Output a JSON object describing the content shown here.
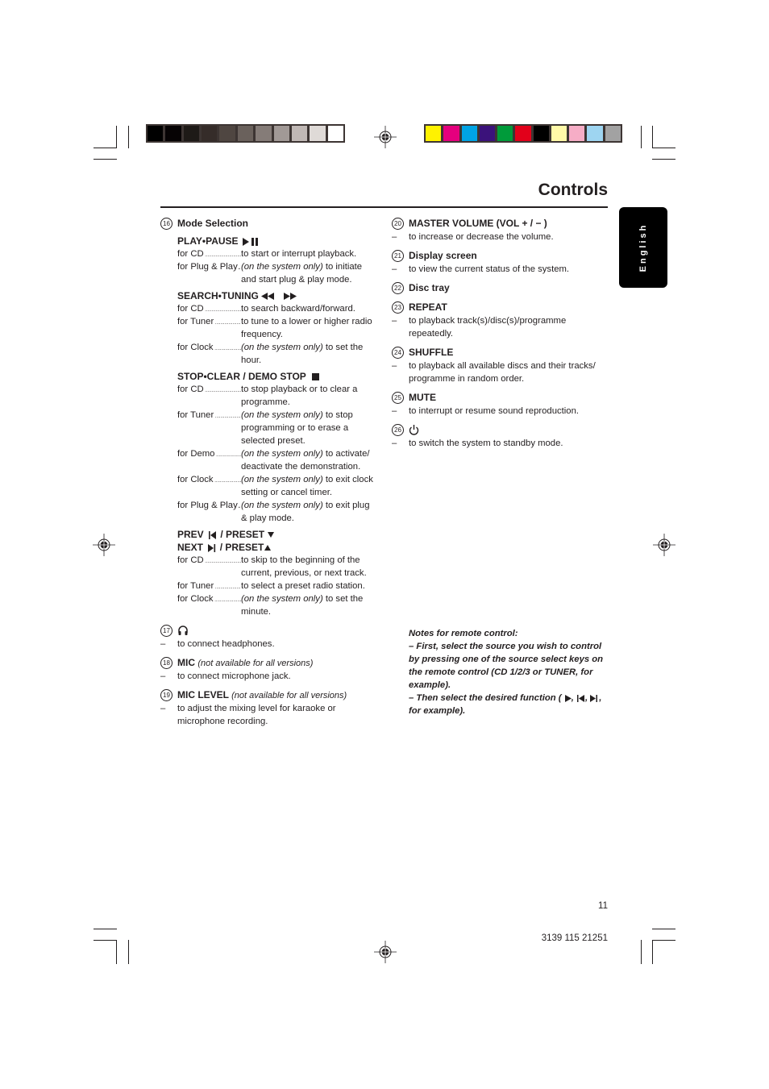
{
  "print_marks": {
    "grayscale_bar": [
      "#000000",
      "#060304",
      "#1e1a17",
      "#352c29",
      "#4f4641",
      "#6a615c",
      "#857c78",
      "#a19996",
      "#c0b8b5",
      "#dfdad7",
      "#ffffff"
    ],
    "color_bar": [
      "#fff200",
      "#e5007e",
      "#00a4e4",
      "#3b127b",
      "#009b3a",
      "#e2001a",
      "#000000",
      "#fff9a8",
      "#f6adc6",
      "#9ed5f1",
      "#a2a2a2"
    ]
  },
  "page": {
    "title": "Controls",
    "language_tab": "English",
    "page_number": "11",
    "doc_code": "3139 115 21251"
  },
  "left_column": {
    "item16": {
      "number": "16",
      "heading": "Mode Selection",
      "play_pause": {
        "heading": "PLAY•PAUSE",
        "icon": "play-pause-icon",
        "rows": [
          {
            "label": "for CD",
            "prefix_italic": "",
            "text": "to start or interrupt playback."
          },
          {
            "label": "for Plug & Play…",
            "prefix_italic": "(on the system only)",
            "text": " to initiate and start plug & play mode."
          }
        ]
      },
      "search_tuning": {
        "heading": "SEARCH•TUNING",
        "icons": [
          "rewind-icon",
          "fast-forward-icon"
        ],
        "rows": [
          {
            "label": "for CD",
            "prefix_italic": "",
            "text": "to search backward/forward."
          },
          {
            "label": "for Tuner",
            "prefix_italic": "",
            "text": "to tune to a lower or higher radio frequency."
          },
          {
            "label": "for Clock",
            "prefix_italic": "(on the system only)",
            "text": " to set the hour."
          }
        ]
      },
      "stop_clear": {
        "heading": "STOP•CLEAR / DEMO STOP",
        "icon": "stop-icon",
        "rows": [
          {
            "label": "for CD",
            "prefix_italic": "",
            "text": "to stop playback or to clear a programme."
          },
          {
            "label": "for Tuner",
            "prefix_italic": "(on the system only)",
            "text": " to stop programming or to erase a selected preset."
          },
          {
            "label": "for Demo",
            "prefix_italic": "(on the system only)",
            "text": " to activate/ deactivate the demonstration."
          },
          {
            "label": "for Clock",
            "prefix_italic": "(on the system only)",
            "text": " to exit clock setting or cancel timer."
          },
          {
            "label": "for Plug & Play…",
            "prefix_italic": "(on the system only)",
            "text": " to exit plug & play mode."
          }
        ]
      },
      "prev_next": {
        "heading_line1_a": "PREV",
        "heading_line1_b": "/ PRESET",
        "heading_line2_a": "NEXT",
        "heading_line2_b": "/ PRESET",
        "rows": [
          {
            "label": "for CD",
            "prefix_italic": "",
            "text": "to skip to the beginning of the current, previous, or next track."
          },
          {
            "label": "for Tuner",
            "prefix_italic": "",
            "text": "to select a preset radio station."
          },
          {
            "label": "for Clock",
            "prefix_italic": "(on the system only)",
            "text": " to set the minute."
          }
        ]
      }
    },
    "item17": {
      "number": "17",
      "icon": "headphones-icon",
      "desc": "to connect headphones."
    },
    "item18": {
      "number": "18",
      "heading": "MIC",
      "note": "(not available for all versions)",
      "desc": "to connect microphone jack."
    },
    "item19": {
      "number": "19",
      "heading": "MIC LEVEL",
      "note": "(not available for all versions)",
      "desc": "to adjust the mixing level for karaoke or microphone recording."
    }
  },
  "right_column": {
    "items": [
      {
        "number": "20",
        "heading": "MASTER VOLUME  (VOL  + / − )",
        "desc": "to increase or decrease the volume."
      },
      {
        "number": "21",
        "heading": "Display screen",
        "desc": "to view the current status of the system."
      },
      {
        "number": "22",
        "heading": "Disc tray",
        "desc": ""
      },
      {
        "number": "23",
        "heading": "REPEAT",
        "desc": "to playback track(s)/disc(s)/programme repeatedly."
      },
      {
        "number": "24",
        "heading": "SHUFFLE",
        "desc": "to playback all available discs and their tracks/ programme in random order."
      },
      {
        "number": "25",
        "heading": "MUTE",
        "desc": "to interrupt or resume sound reproduction."
      },
      {
        "number": "26",
        "heading": "",
        "icon": "power-standby-icon",
        "desc": "to switch the system to standby mode."
      }
    ],
    "dash": "–"
  },
  "notes": {
    "title": "Notes for remote control:",
    "line1": "–  First, select the source you wish to control by pressing one of the source select keys on the remote control (CD 1/2/3 or TUNER, for example).",
    "line2_a": "–  Then select the desired function ( ",
    "line2_b": ", ",
    "line2_c": ", ",
    "line2_d": ", for example)."
  }
}
